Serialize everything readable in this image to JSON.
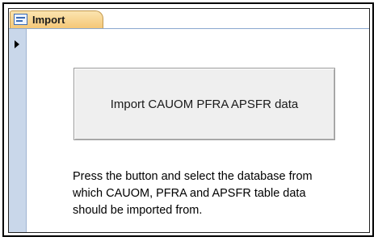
{
  "tab": {
    "label": "Import",
    "icon": "form-icon"
  },
  "form": {
    "record_selector_icon": "record-pointer-icon",
    "button_label": "Import CAUOM PFRA APSFR data",
    "instructions": "Press the button and select the database from which CAUOM, PFRA and APSFR table data should be imported from."
  },
  "colors": {
    "tab_fill": "#f4c777",
    "rail_fill": "#c9d7ea",
    "button_fill": "#efefef"
  }
}
